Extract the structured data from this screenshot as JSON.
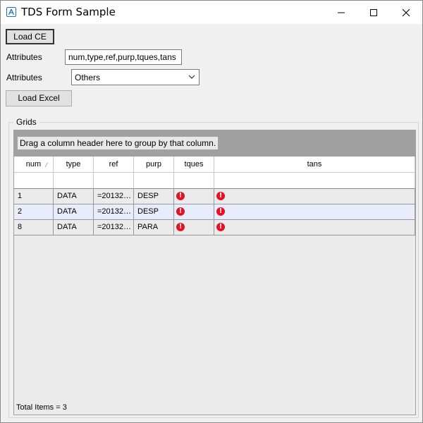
{
  "window": {
    "title": "TDS Form Sample"
  },
  "buttons": {
    "load_ce": "Load CE",
    "load_excel": "Load Excel"
  },
  "attributes_text": {
    "label": "Attributes",
    "value": "num,type,ref,purp,tques,tans"
  },
  "attributes_combo": {
    "label": "Attributes",
    "selected": "Others"
  },
  "grid": {
    "group_title": "Grids",
    "group_hint": "Drag a column header here to group by that column.",
    "columns": [
      "num",
      "type",
      "ref",
      "purp",
      "tques",
      "tans"
    ],
    "sorted_column": "num",
    "rows": [
      {
        "num": "1",
        "type": "DATA",
        "ref": "=20132…",
        "purp": "DESP",
        "tques": "error-icon",
        "tans": "error-icon"
      },
      {
        "num": "2",
        "type": "DATA",
        "ref": "=20132…",
        "purp": "DESP",
        "tques": "error-icon",
        "tans": "error-icon"
      },
      {
        "num": "8",
        "type": "DATA",
        "ref": "=20132…",
        "purp": "PARA",
        "tques": "error-icon",
        "tans": "error-icon"
      }
    ],
    "selected_row_index": 1,
    "footer": "Total Items = 3"
  },
  "colors": {
    "selected_row": "#e8ecfb",
    "error": "#e81123",
    "group_panel": "#a0a0a0"
  }
}
